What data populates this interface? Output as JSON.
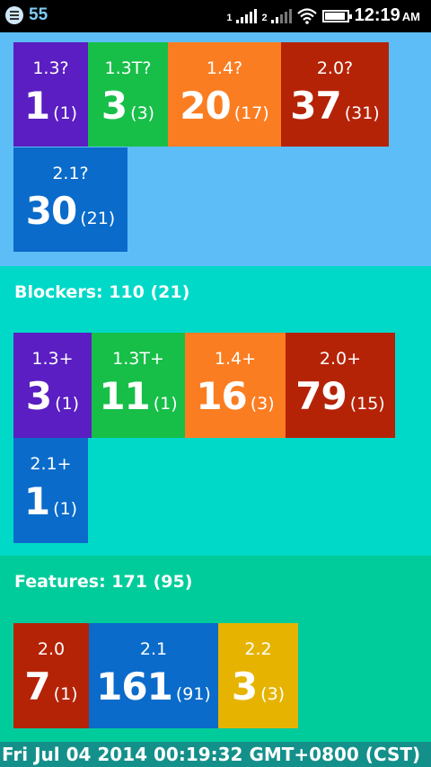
{
  "status_bar": {
    "notification_count": "55",
    "sim1_label": "1",
    "sim2_label": "2",
    "time": "12:19",
    "ampm": "AM"
  },
  "unassigned": {
    "tiles": [
      {
        "label": "1.3?",
        "big": "1",
        "small": "(1)",
        "color": "#5a1ec2"
      },
      {
        "label": "1.3T?",
        "big": "3",
        "small": "(3)",
        "color": "#17bf48"
      },
      {
        "label": "1.4?",
        "big": "20",
        "small": "(17)",
        "color": "#fb7d22"
      },
      {
        "label": "2.0?",
        "big": "37",
        "small": "(31)",
        "color": "#b52307"
      },
      {
        "label": "2.1?",
        "big": "30",
        "small": "(21)",
        "color": "#0a6bca"
      }
    ]
  },
  "blockers": {
    "title": "Blockers: 110 (21)",
    "tiles": [
      {
        "label": "1.3+",
        "big": "3",
        "small": "(1)",
        "color": "#5a1ec2"
      },
      {
        "label": "1.3T+",
        "big": "11",
        "small": "(1)",
        "color": "#17bf48"
      },
      {
        "label": "1.4+",
        "big": "16",
        "small": "(3)",
        "color": "#fb7d22"
      },
      {
        "label": "2.0+",
        "big": "79",
        "small": "(15)",
        "color": "#b52307"
      },
      {
        "label": "2.1+",
        "big": "1",
        "small": "(1)",
        "color": "#0a6bca"
      }
    ]
  },
  "features": {
    "title": "Features: 171 (95)",
    "tiles": [
      {
        "label": "2.0",
        "big": "7",
        "small": "(1)",
        "color": "#b52307"
      },
      {
        "label": "2.1",
        "big": "161",
        "small": "(91)",
        "color": "#0a6bca"
      },
      {
        "label": "2.2",
        "big": "3",
        "small": "(3)",
        "color": "#e6b400"
      }
    ]
  },
  "footer": {
    "timestamp": "Fri Jul 04 2014 00:19:32 GMT+0800 (CST)"
  }
}
